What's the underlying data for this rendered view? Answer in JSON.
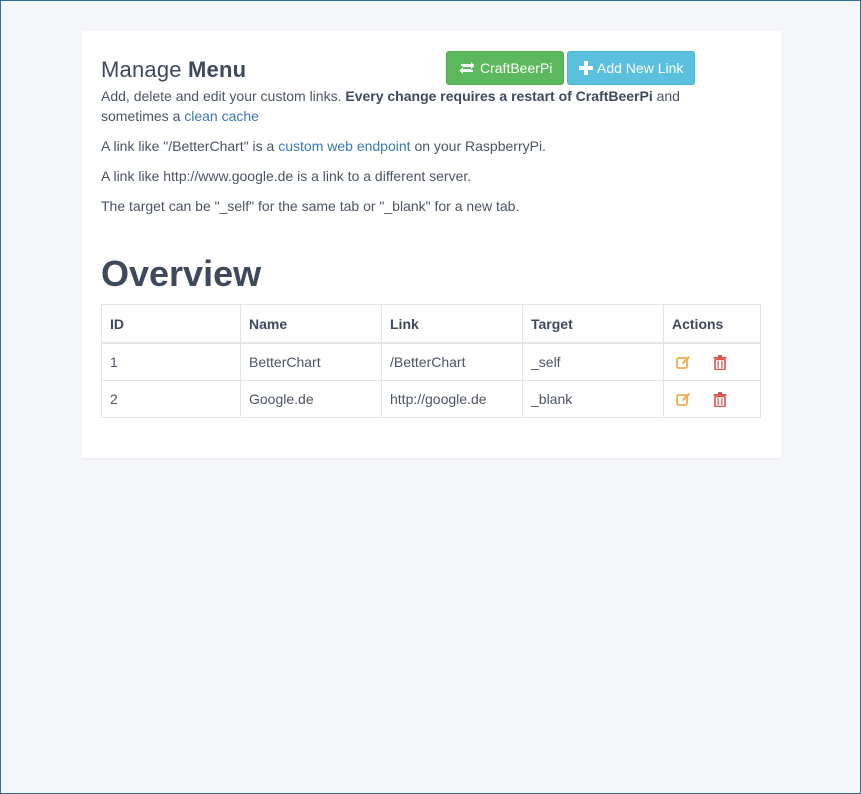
{
  "header": {
    "title_prefix": "Manage",
    "title_bold": "Menu",
    "craftbeerpi_button": "CraftBeerPi",
    "add_link_button": "Add New Link"
  },
  "description": {
    "line1_text": "Add, delete and edit your custom links.",
    "line1_bold": "Every change requires a restart of CraftBeerPi",
    "line1_and": "and sometimes a",
    "line1_link": "clean cache",
    "line2_pre": "A link like \"/BetterChart\" is a",
    "line2_link": "custom web endpoint",
    "line2_post": "on your RaspberryPi.",
    "line3": "A link like http://www.google.de is a link to a different server.",
    "line4": "The target can be \"_self\" for the same tab or \"_blank\" for a new tab."
  },
  "overview": {
    "heading": "Overview",
    "columns": [
      "ID",
      "Name",
      "Link",
      "Target",
      "Actions"
    ],
    "rows": [
      {
        "id": "1",
        "name": "BetterChart",
        "link": "/BetterChart",
        "target": "_self"
      },
      {
        "id": "2",
        "name": "Google.de",
        "link": "http://google.de",
        "target": "_blank"
      }
    ]
  },
  "icons": {
    "refresh": "refresh-icon",
    "plus": "plus-icon",
    "edit": "edit-icon",
    "delete": "trash-icon"
  },
  "colors": {
    "green": "#5cb85c",
    "blue": "#5bc0de",
    "edit": "#f0ad4e",
    "delete": "#d9534f",
    "link": "#3b79b3"
  }
}
